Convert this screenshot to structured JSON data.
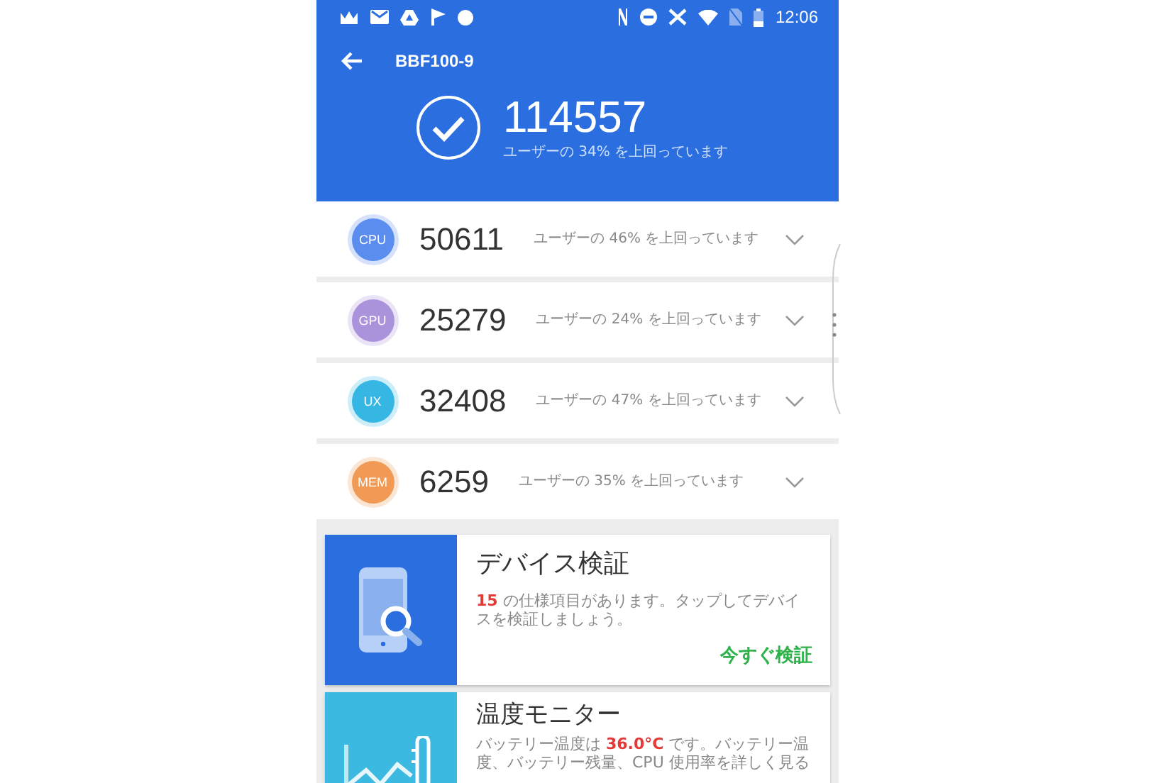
{
  "status_bar": {
    "time": "12:06"
  },
  "app_bar": {
    "title": "BBF100-9"
  },
  "total": {
    "score": "114557",
    "caption": "ユーザーの 34% を上回っています"
  },
  "scores": [
    {
      "label": "CPU",
      "color": "#5b8def",
      "score": "50611",
      "caption": "ユーザーの 46% を上回っています",
      "expanded": false
    },
    {
      "label": "GPU",
      "color": "#ab93dc",
      "score": "25279",
      "caption": "ユーザーの 24% を上回っています",
      "expanded": false
    },
    {
      "label": "UX",
      "color": "#36b6e2",
      "score": "32408",
      "caption": "ユーザーの 47% を上回っています",
      "expanded": false
    },
    {
      "label": "MEM",
      "color": "#f09a55",
      "score": "6259",
      "caption": "ユーザーの 35% を上回っています",
      "expanded": false
    }
  ],
  "cards": [
    {
      "kind": "verify",
      "color": "#2a6ee0",
      "title": "デバイス検証",
      "text": "**15** の仕様項目があります。タップしてデバイスを検証しましょう。",
      "action": "今すぐ検証"
    },
    {
      "kind": "temperature",
      "color": "#3bb9e0",
      "title": "温度モニター",
      "text": "バッテリー温度は **36.0°C** です。バッテリー温度、バッテリー残量、CPU 使用率を詳しく見る"
    }
  ]
}
